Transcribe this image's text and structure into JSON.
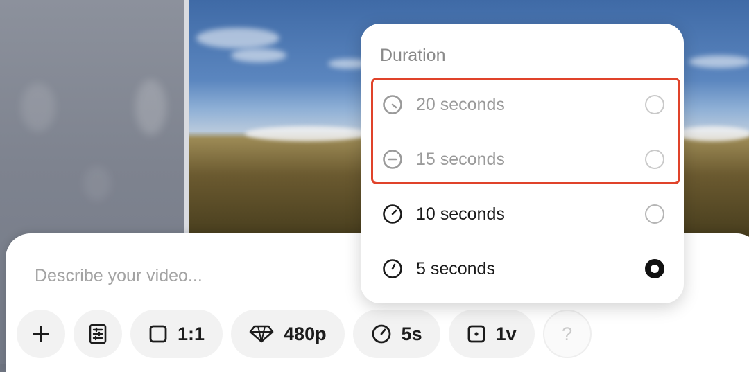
{
  "prompt": {
    "placeholder": "Describe your video..."
  },
  "toolbar": {
    "add_icon": "plus-icon",
    "storyboard_icon": "document-list-icon",
    "aspect": {
      "label": "1:1",
      "icon": "square-icon"
    },
    "quality": {
      "label": "480p",
      "icon": "diamond-icon"
    },
    "duration": {
      "label": "5s",
      "icon": "timer-icon"
    },
    "variations": {
      "label": "1v",
      "icon": "frame-dot-icon"
    },
    "help_label": "?"
  },
  "duration_menu": {
    "title": "Duration",
    "options": [
      {
        "label": "20 seconds",
        "enabled": false,
        "selected": false
      },
      {
        "label": "15 seconds",
        "enabled": false,
        "selected": false
      },
      {
        "label": "10 seconds",
        "enabled": true,
        "selected": false
      },
      {
        "label": "5 seconds",
        "enabled": true,
        "selected": true
      }
    ],
    "highlight_color": "#e0432a"
  }
}
